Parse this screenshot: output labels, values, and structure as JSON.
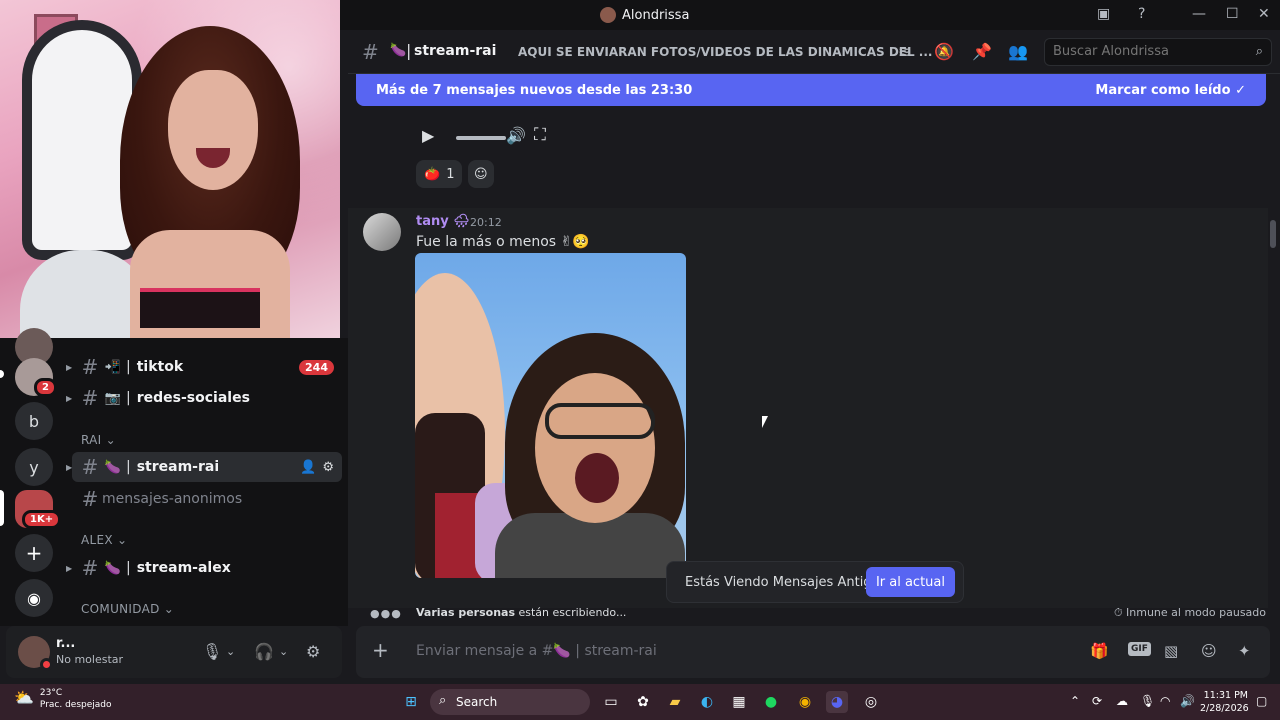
{
  "window": {
    "title": "Alondrissa"
  },
  "servers": [
    {
      "label": "",
      "badge": "2"
    },
    {
      "label": "b"
    },
    {
      "label": "y"
    },
    {
      "label": "",
      "badge": "1K+"
    }
  ],
  "sidebar": {
    "channels_top": [
      {
        "emoji": "📲",
        "name": "tiktok",
        "count": "244"
      },
      {
        "emoji": "📷",
        "name": "redes-sociales"
      }
    ],
    "cat_rai": "RAI",
    "rai_channels": [
      {
        "emoji": "🍆",
        "name": "stream-rai"
      },
      {
        "name": "mensajes-anonimos"
      }
    ],
    "cat_alex": "ALEX",
    "alex_channels": [
      {
        "emoji": "🍆",
        "name": "stream-alex"
      }
    ],
    "cat_comunidad": "COMUNIDAD"
  },
  "user": {
    "name": "r...",
    "status": "No molestar"
  },
  "header": {
    "channel_emoji": "🍆",
    "channel_name": "stream-rai",
    "topic": "AQUI SE ENVIARAN FOTOS/VIDEOS DE LAS DINAMICAS DEL ...",
    "search_placeholder": "Buscar Alondrissa"
  },
  "new_bar": {
    "text": "Más de 7 mensajes nuevos desde las 23:30",
    "action": "Marcar como leído"
  },
  "reactions_top": {
    "emoji": "🍅",
    "count": "1"
  },
  "message": {
    "author": "tany",
    "author_badge": "🌧",
    "time": "20:12",
    "text": "Fue la más o menos ✌🥺"
  },
  "old_bar": {
    "text": "Estás Viendo Mensajes Antiguos",
    "button": "Ir al actual"
  },
  "typing": {
    "who": "Varias personas",
    "rest": "están escribiendo..."
  },
  "immune": "Inmune al modo pausado",
  "composer": {
    "placeholder": "Enviar mensaje a #🍆 | stream-rai"
  },
  "taskbar": {
    "temp": "23°C",
    "weather": "Prac. despejado",
    "search": "Search",
    "time": "11:31 PM",
    "date": "2/28/2026"
  }
}
